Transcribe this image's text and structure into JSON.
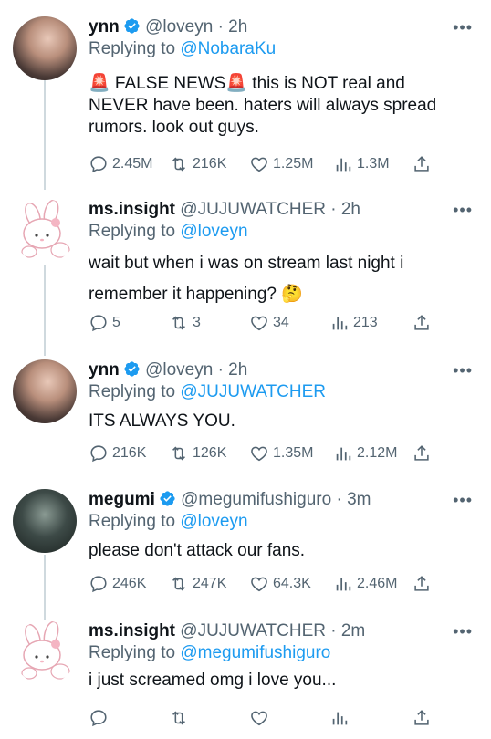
{
  "tweets": [
    {
      "name": "ynn",
      "verified": true,
      "handle": "@loveyn",
      "time": "2h",
      "reply_prefix": "Replying to",
      "reply_to": "@NobaraKu",
      "text_lines": [
        "🚨 FALSE NEWS🚨  this is NOT real and",
        "NEVER have been. haters will always spread",
        "rumors. look out guys."
      ],
      "replies": "2.45M",
      "retweets": "216K",
      "likes": "1.25M",
      "views": "1.3M"
    },
    {
      "name": "ms.insight",
      "verified": false,
      "handle": "@JUJUWATCHER",
      "time": "2h",
      "reply_prefix": "Replying to",
      "reply_to": "@loveyn",
      "text_lines": [
        "wait but when i was on stream last night i",
        "remember it happening? 🤔"
      ],
      "replies": "5",
      "retweets": "3",
      "likes": "34",
      "views": "213"
    },
    {
      "name": "ynn",
      "verified": true,
      "handle": "@loveyn",
      "time": "2h",
      "reply_prefix": "Replying to",
      "reply_to": "@JUJUWATCHER",
      "text_lines": [
        "ITS ALWAYS YOU."
      ],
      "replies": "216K",
      "retweets": "126K",
      "likes": "1.35M",
      "views": "2.12M"
    },
    {
      "name": "megumi",
      "verified": true,
      "handle": "@megumifushiguro",
      "time": "3m",
      "reply_prefix": "Replying to",
      "reply_to": "@loveyn",
      "text_lines": [
        "please don't attack our fans."
      ],
      "replies": "246K",
      "retweets": "247K",
      "likes": "64.3K",
      "views": "2.46M"
    },
    {
      "name": "ms.insight",
      "verified": false,
      "handle": "@JUJUWATCHER",
      "time": "2m",
      "reply_prefix": "Replying to",
      "reply_to": "@megumifushiguro",
      "text_lines": [
        "i just screamed omg i love you..."
      ],
      "replies": "",
      "retweets": "",
      "likes": "",
      "views": ""
    }
  ],
  "more_label": "•••",
  "dot": "·",
  "icons": {
    "reply": "comment-icon",
    "retweet": "retweet-icon",
    "like": "heart-icon",
    "views": "views-chart-icon",
    "share": "share-icon",
    "verified": "verified-badge-icon"
  },
  "colors": {
    "link": "#1d9bf0",
    "muted": "#536471",
    "text": "#0f1419",
    "line": "#cfd9de"
  }
}
